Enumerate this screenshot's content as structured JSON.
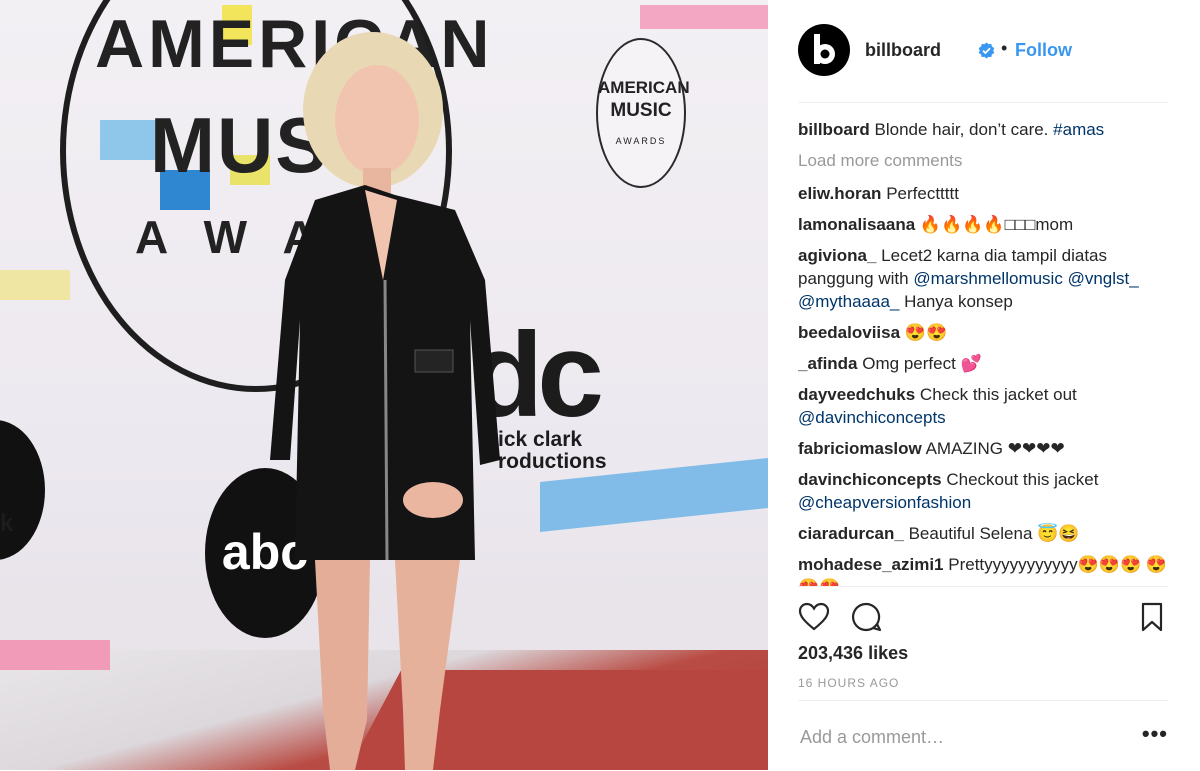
{
  "photo": {
    "alt_marks": {
      "wordmark_line1": "AMERICAN",
      "wordmark_line2": "MUSI",
      "wordmark_line3": "AWA",
      "sticker_line1": "AMERICAN",
      "sticker_line2": "MUSIC",
      "sticker_line3": "AWARDS",
      "abc_logo": "abc",
      "dcp_mark": "dc",
      "dcp_line1": "ick clark",
      "dcp_line2": "roductions",
      "left_edge_text": "k"
    }
  },
  "post": {
    "account": "billboard",
    "verified": true,
    "follow_label": "Follow",
    "caption_user": "billboard",
    "caption_text": "Blonde hair, don’t care.",
    "caption_tag": "#amas",
    "load_more": "Load more comments",
    "comments": [
      {
        "user": "eliw.horan",
        "text": "Perfecttttt"
      },
      {
        "user": "lamonalisaana",
        "text": "🔥🔥🔥🔥□□□mom"
      },
      {
        "user": "agiviona_",
        "text": "Lecet2 karna dia tampil diatas panggung with",
        "mention1": "@marshmellomusic",
        "mention2": "@vnglst_",
        "mention3": "@mythaaaa_",
        "tail": "Hanya konsep"
      },
      {
        "user": "beedaloviisa",
        "text": "😍😍"
      },
      {
        "user": "_afinda",
        "text": "Omg perfect 💕"
      },
      {
        "user": "dayveedchuks",
        "text": "Check this jacket out",
        "mention1": "@davinchiconcepts"
      },
      {
        "user": "fabriciomaslow",
        "text": "AMAZING ❤❤❤❤"
      },
      {
        "user": "davinchiconcepts",
        "text": "Checkout this jacket",
        "mention1": "@cheapversionfashion"
      },
      {
        "user": "ciaradurcan_",
        "text": "Beautiful Selena 😇😆"
      },
      {
        "user": "mohadese_azimi1",
        "text": "Prettyyyyyyyyyyy😍😍😍",
        "tail": "😍😍😍"
      }
    ],
    "likes": "203,436 likes",
    "time_ago": "16 HOURS AGO",
    "add_comment_placeholder": "Add a comment…",
    "more_options": "•••"
  },
  "icons": {
    "like": "heart-icon",
    "comment": "comment-icon",
    "save": "bookmark-icon",
    "verified": "verified-badge-icon"
  },
  "colors": {
    "link_blue": "#3897f0",
    "mention_blue": "#003569",
    "muted": "#999999",
    "text": "#262626"
  }
}
